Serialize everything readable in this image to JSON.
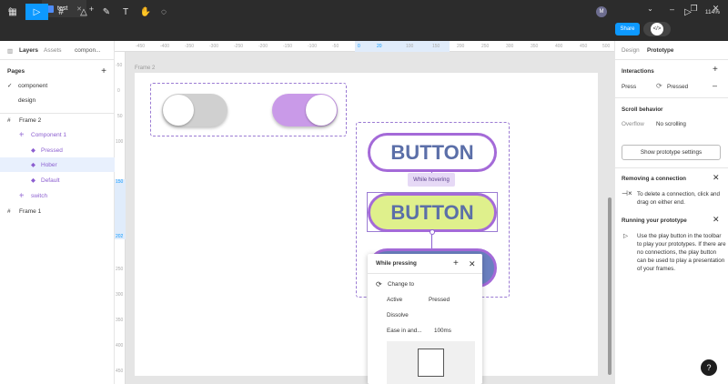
{
  "tabs": {
    "active": "test"
  },
  "toolbar": {
    "share": "Share",
    "zoom": "114%"
  },
  "left": {
    "tab_layers": "Layers",
    "tab_assets": "Assets",
    "page_selector": "compon...",
    "pages_title": "Pages",
    "pages": [
      "component",
      "design"
    ],
    "layers": [
      "Frame 2",
      "Component 1",
      "Pressed",
      "Hober",
      "Default",
      "switch",
      "Frame 1"
    ]
  },
  "canvas": {
    "frame_label": "Frame 2",
    "ruler_top": [
      "-450",
      "-400",
      "-350",
      "-300",
      "-250",
      "-200",
      "-150",
      "-100",
      "-50",
      "0",
      "20",
      "100",
      "150",
      "200",
      "250",
      "300",
      "350",
      "400",
      "450",
      "500"
    ],
    "ruler_left": [
      "-50",
      "0",
      "50",
      "100",
      "150",
      "202",
      "250",
      "300",
      "350",
      "400",
      "450"
    ],
    "button_top": "BUTTON",
    "button_mid": "BUTTON",
    "hover_label": "While hovering",
    "colors": {
      "accent": "#8c5fd0",
      "lime": "#dff08c",
      "button_text": "#5b6fa8",
      "toggle_on": "#c99ae8"
    }
  },
  "popup": {
    "title": "While pressing",
    "change_to": "Change to",
    "active_label": "Active",
    "active_value": "Pressed",
    "dissolve": "Dissolve",
    "ease": "Ease in and...",
    "duration": "100ms"
  },
  "right": {
    "tab_design": "Design",
    "tab_prototype": "Prototype",
    "interactions_title": "Interactions",
    "trigger": "Press",
    "destination": "Pressed",
    "scroll_title": "Scroll behavior",
    "overflow_label": "Overflow",
    "overflow_value": "No scrolling",
    "show_settings": "Show prototype settings",
    "removing_title": "Removing a connection",
    "removing_text": "To delete a connection, click and drag on either end.",
    "running_title": "Running your prototype",
    "running_text": "Use the play button in the toolbar to play your prototypes. If there are no connections, the play button can be used to play a presentation of your frames.",
    "help": "?"
  }
}
